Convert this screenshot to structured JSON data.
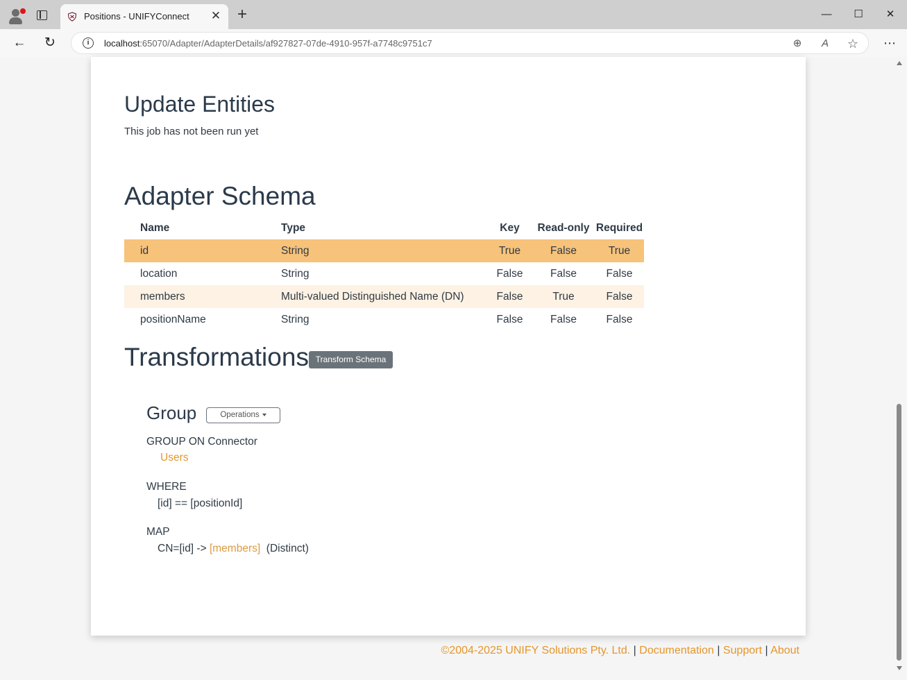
{
  "browser": {
    "tab_title": "Positions - UNIFYConnect",
    "tab_close": "✕",
    "new_tab": "+",
    "url_host": "localhost",
    "url_rest": ":65070/Adapter/AdapterDetails/af927827-07de-4910-957f-a7748c9751c7",
    "window": {
      "minimize": "—",
      "maximize": "☐",
      "close": "✕"
    },
    "nav": {
      "back": "←",
      "reload": "↻"
    },
    "icons": {
      "info": "i",
      "zoom": "⊕",
      "read_aloud": "A",
      "favorite": "☆",
      "menu": "⋯"
    }
  },
  "update_entities": {
    "heading": "Update Entities",
    "status": "This job has not been run yet"
  },
  "adapter_schema": {
    "heading": "Adapter Schema",
    "columns": [
      "Name",
      "Type",
      "Key",
      "Read-only",
      "Required"
    ],
    "rows": [
      {
        "name": "id",
        "type": "String",
        "key": "True",
        "readonly": "False",
        "required": "True"
      },
      {
        "name": "location",
        "type": "String",
        "key": "False",
        "readonly": "False",
        "required": "False"
      },
      {
        "name": "members",
        "type": "Multi-valued Distinguished Name (DN)",
        "key": "False",
        "readonly": "True",
        "required": "False"
      },
      {
        "name": "positionName",
        "type": "String",
        "key": "False",
        "readonly": "False",
        "required": "False"
      }
    ]
  },
  "transformations": {
    "heading": "Transformations",
    "transform_button": "Transform Schema",
    "group": {
      "heading": "Group",
      "operations_button": "Operations",
      "group_on": "GROUP ON Connector",
      "connector": "Users",
      "where_label": "WHERE",
      "where_expr": "[id] == [positionId]",
      "map_label": "MAP",
      "map_source": "CN=[id] ->",
      "map_target": "[members]",
      "map_modifier": "(Distinct)"
    }
  },
  "footer": {
    "copyright": "©2004-2025 UNIFY Solutions Pty. Ltd.",
    "separator": "|",
    "documentation": "Documentation",
    "support": "Support",
    "about": "About"
  },
  "colors": {
    "accent": "#e5962b",
    "selected_row": "#f7c27a",
    "alt_row": "#fdf2e3",
    "button_secondary": "#6b737a"
  }
}
